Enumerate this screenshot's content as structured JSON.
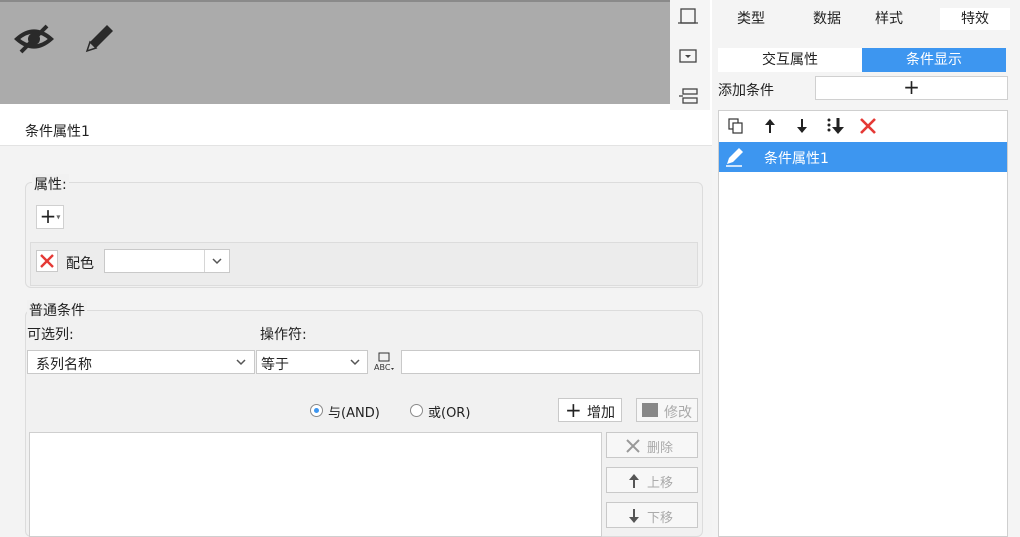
{
  "canvas": {
    "hide_icon": "eye-slash-icon",
    "edit_icon": "pencil-icon"
  },
  "side_tabs": [
    "类型",
    "数据",
    "样式",
    "特效"
  ],
  "segments": {
    "left": "交互属性",
    "right": "条件显示",
    "active": "right"
  },
  "add_condition": {
    "label": "添加条件",
    "plus": "+"
  },
  "condition_list": {
    "items": [
      "条件属性1"
    ]
  },
  "colors": {
    "accent": "#3d96f0",
    "delete_red": "#e53935"
  },
  "dialog": {
    "title": "条件属性1",
    "attribute_group_label": "属性:",
    "add_attr_glyph": "+",
    "attr_rows": [
      {
        "name": "配色",
        "value": ""
      }
    ],
    "normal_condition_label": "普通条件",
    "optional_column_label": "可选列:",
    "operator_label": "操作符:",
    "column_value": "系列名称",
    "operator_value": "等于",
    "value_input": "",
    "and_label": "与(AND)",
    "or_label": "或(OR)",
    "logic_selected": "and",
    "add_button": "增加",
    "modify_button": "修改",
    "delete_button": "删除",
    "move_up_button": "上移",
    "move_down_button": "下移"
  }
}
